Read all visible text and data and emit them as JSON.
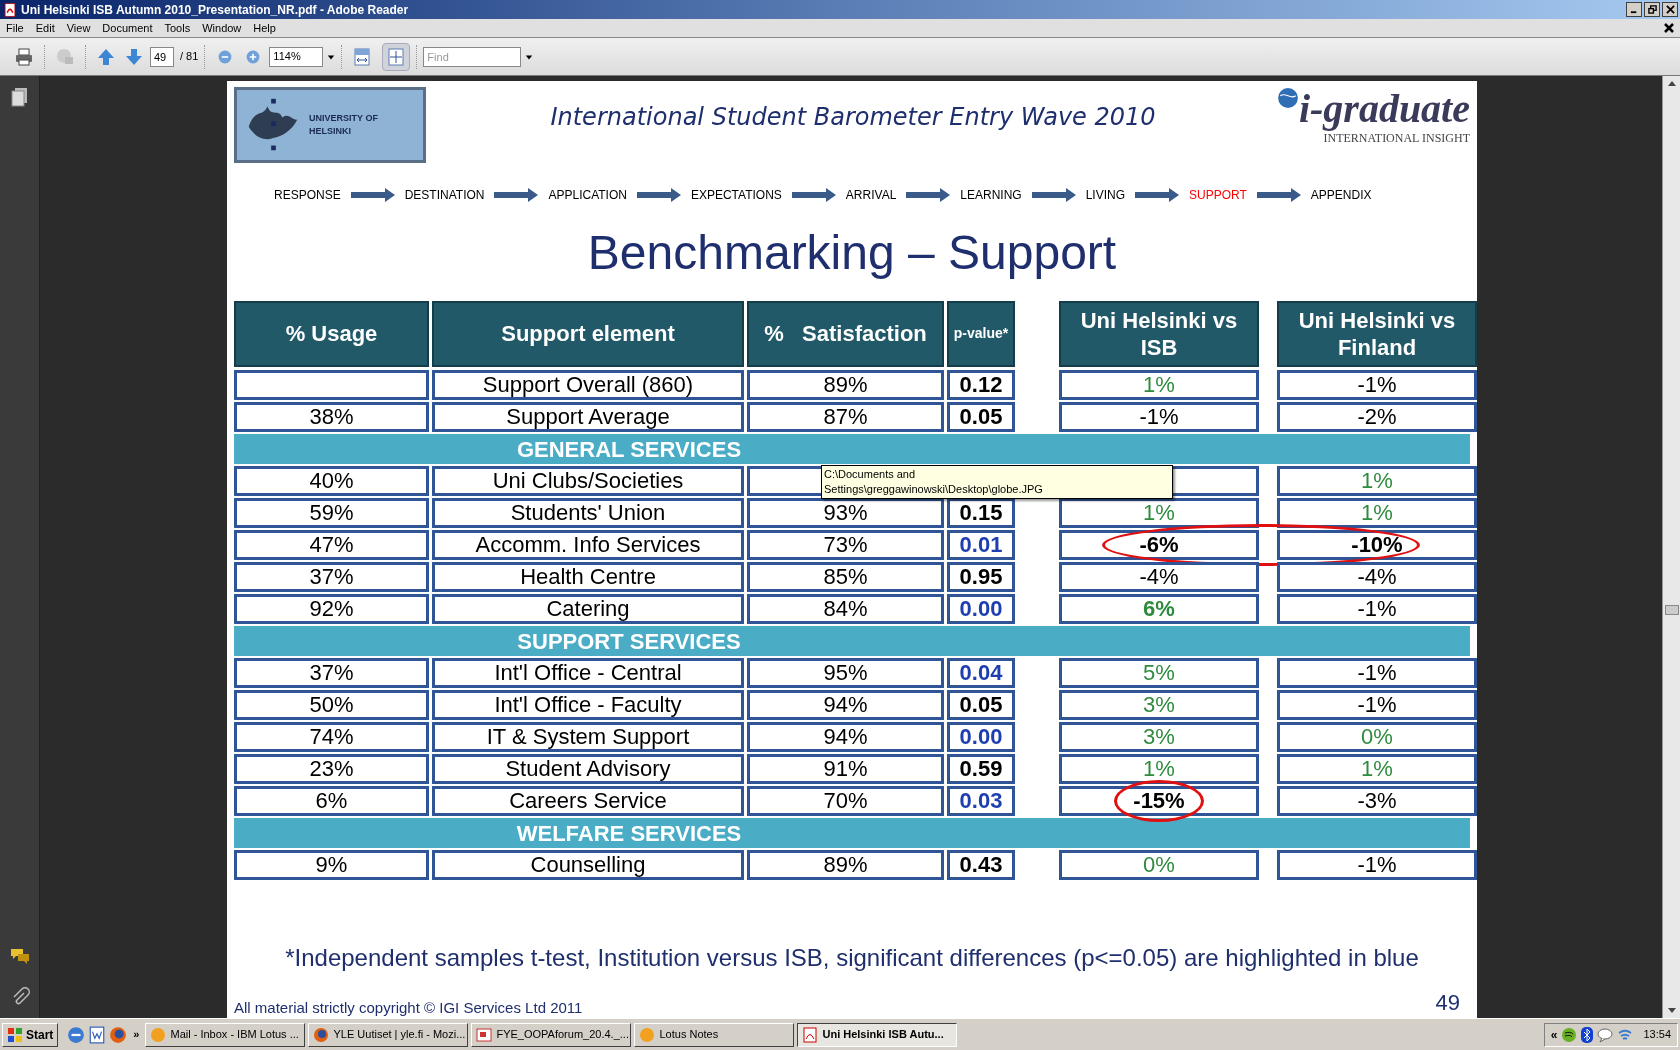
{
  "window": {
    "title": "Uni Helsinki ISB Autumn 2010_Presentation_NR.pdf - Adobe Reader"
  },
  "menu": [
    "File",
    "Edit",
    "View",
    "Document",
    "Tools",
    "Window",
    "Help"
  ],
  "toolbar": {
    "page": "49",
    "page_count": "/ 81",
    "zoom": "114%",
    "find_placeholder": "Find"
  },
  "slide": {
    "logo_text": "UNIVERSITY OF HELSINKI",
    "header": "International Student Barometer Entry Wave 2010",
    "brand": "i-graduate",
    "brand_tagline": "INTERNATIONAL INSIGHT",
    "steps": [
      {
        "label": "RESPONSE",
        "selected": false
      },
      {
        "label": "DESTINATION",
        "selected": false
      },
      {
        "label": "APPLICATION",
        "selected": false
      },
      {
        "label": "EXPECTATIONS",
        "selected": false
      },
      {
        "label": "ARRIVAL",
        "selected": false
      },
      {
        "label": "LEARNING",
        "selected": false
      },
      {
        "label": "LIVING",
        "selected": false
      },
      {
        "label": "SUPPORT",
        "selected": true
      },
      {
        "label": "APPENDIX",
        "selected": false
      }
    ],
    "title": "Benchmarking – Support",
    "columns": [
      "% Usage",
      "Support element",
      "%   Satisfaction",
      "p-value*",
      "Uni Helsinki vs ISB",
      "Uni Helsinki vs Finland"
    ],
    "rows": [
      {
        "kind": "data",
        "element": "Support Overall (860)",
        "satisfaction": "89%",
        "p_value": {
          "text": "0.12",
          "significant": false
        },
        "vs_isb": {
          "text": "1%",
          "color": "#2e8b3e",
          "bold": false
        },
        "vs_finland": {
          "text": "-1%",
          "color": "#000000",
          "bold": false
        }
      },
      {
        "kind": "data",
        "usage": "38%",
        "element": "Support Average",
        "satisfaction": "87%",
        "p_value": {
          "text": "0.05",
          "significant": false
        },
        "vs_isb": {
          "text": "-1%",
          "color": "#000000",
          "bold": false
        },
        "vs_finland": {
          "text": "-2%",
          "color": "#000000",
          "bold": false
        }
      },
      {
        "kind": "section",
        "label": "GENERAL SERVICES"
      },
      {
        "kind": "data",
        "usage": "40%",
        "element": "Uni Clubs/Societies",
        "vs_finland": {
          "text": "1%",
          "color": "#2e8b3e",
          "bold": false
        }
      },
      {
        "kind": "data",
        "usage": "59%",
        "element": "Students' Union",
        "satisfaction": "93%",
        "p_value": {
          "text": "0.15",
          "significant": false
        },
        "vs_isb": {
          "text": "1%",
          "color": "#2e8b3e",
          "bold": false
        },
        "vs_finland": {
          "text": "1%",
          "color": "#2e8b3e",
          "bold": false
        }
      },
      {
        "kind": "data",
        "usage": "47%",
        "element": "Accomm. Info Services",
        "satisfaction": "73%",
        "p_value": {
          "text": "0.01",
          "significant": true
        },
        "vs_isb": {
          "text": "-6%",
          "color": "#000000",
          "bold": true,
          "circled": true
        },
        "vs_finland": {
          "text": "-10%",
          "color": "#000000",
          "bold": true,
          "circled": true
        }
      },
      {
        "kind": "data",
        "usage": "37%",
        "element": "Health Centre",
        "satisfaction": "85%",
        "p_value": {
          "text": "0.95",
          "significant": false
        },
        "vs_isb": {
          "text": "-4%",
          "color": "#000000",
          "bold": false
        },
        "vs_finland": {
          "text": "-4%",
          "color": "#000000",
          "bold": false
        }
      },
      {
        "kind": "data",
        "usage": "92%",
        "element": "Catering",
        "satisfaction": "84%",
        "p_value": {
          "text": "0.00",
          "significant": true
        },
        "vs_isb": {
          "text": "6%",
          "color": "#2e8b3e",
          "bold": true
        },
        "vs_finland": {
          "text": "-1%",
          "color": "#000000",
          "bold": false
        }
      },
      {
        "kind": "section",
        "label": "SUPPORT SERVICES"
      },
      {
        "kind": "data",
        "usage": "37%",
        "element": "Int'l Office - Central",
        "satisfaction": "95%",
        "p_value": {
          "text": "0.04",
          "significant": true
        },
        "vs_isb": {
          "text": "5%",
          "color": "#2e8b3e",
          "bold": false
        },
        "vs_finland": {
          "text": "-1%",
          "color": "#000000",
          "bold": false
        }
      },
      {
        "kind": "data",
        "usage": "50%",
        "element": "Int'l Office - Faculty",
        "satisfaction": "94%",
        "p_value": {
          "text": "0.05",
          "significant": false
        },
        "vs_isb": {
          "text": "3%",
          "color": "#2e8b3e",
          "bold": false
        },
        "vs_finland": {
          "text": "-1%",
          "color": "#000000",
          "bold": false
        }
      },
      {
        "kind": "data",
        "usage": "74%",
        "element": "IT & System Support",
        "satisfaction": "94%",
        "p_value": {
          "text": "0.00",
          "significant": true
        },
        "vs_isb": {
          "text": "3%",
          "color": "#2e8b3e",
          "bold": false
        },
        "vs_finland": {
          "text": "0%",
          "color": "#2e8b3e",
          "bold": false
        }
      },
      {
        "kind": "data",
        "usage": "23%",
        "element": "Student Advisory",
        "satisfaction": "91%",
        "p_value": {
          "text": "0.59",
          "significant": false
        },
        "vs_isb": {
          "text": "1%",
          "color": "#2e8b3e",
          "bold": false
        },
        "vs_finland": {
          "text": "1%",
          "color": "#2e8b3e",
          "bold": false
        }
      },
      {
        "kind": "data",
        "usage": "6%",
        "element": "Careers Service",
        "satisfaction": "70%",
        "p_value": {
          "text": "0.03",
          "significant": true
        },
        "vs_isb": {
          "text": "-15%",
          "color": "#000000",
          "bold": true,
          "circled": true
        },
        "vs_finland": {
          "text": "-3%",
          "color": "#000000",
          "bold": false,
          "circled": false
        }
      },
      {
        "kind": "section",
        "label": "WELFARE SERVICES"
      },
      {
        "kind": "data",
        "usage": "9%",
        "element": "Counselling",
        "satisfaction": "89%",
        "p_value": {
          "text": "0.43",
          "significant": false
        },
        "vs_isb": {
          "text": "0%",
          "color": "#2e8b3e",
          "bold": false
        },
        "vs_finland": {
          "text": "-1%",
          "color": "#000000",
          "bold": false
        }
      }
    ],
    "footnote": "*Independent samples t-test, Institution versus ISB, significant differences (p<=0.05) are highlighted in blue",
    "copyright": "All material strictly copyright © IGI Services Ltd 2011",
    "page_number": "49"
  },
  "tooltip": "C:\\Documents and Settings\\greggawinowski\\Desktop\\globe.JPG",
  "taskbar": {
    "start": "Start",
    "tasks": [
      {
        "label": "Mail - Inbox - IBM Lotus ...",
        "kind": "lotus",
        "selected": false
      },
      {
        "label": "YLE Uutiset | yle.fi - Mozi...",
        "kind": "firefox",
        "selected": false
      },
      {
        "label": "FYE_OOPAforum_20.4._...",
        "kind": "slides",
        "selected": false
      },
      {
        "label": "Lotus Notes",
        "kind": "lotus",
        "selected": false
      },
      {
        "label": "Uni Helsinki ISB Autu...",
        "kind": "pdf",
        "selected": true
      }
    ],
    "overflow": "»",
    "tray_expand": "«",
    "clock": "13:54"
  }
}
